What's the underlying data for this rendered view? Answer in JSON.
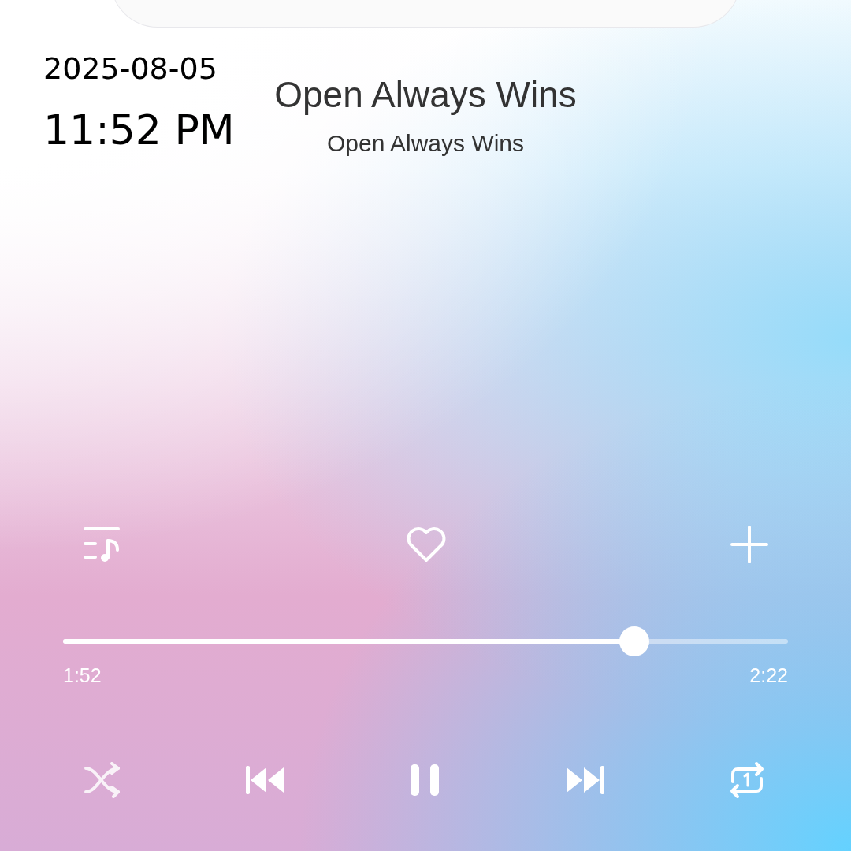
{
  "timestamp": {
    "date": "2025-08-05",
    "time": "11:52 PM"
  },
  "track": {
    "title": "Open Always Wins",
    "artist": "Open Always Wins"
  },
  "actions": {
    "liked": false
  },
  "progress": {
    "level": 0.788,
    "elapsed": "1:52",
    "duration": "2:22"
  },
  "controls": {
    "playing": true,
    "shuffle": false,
    "repeat_one": true
  }
}
